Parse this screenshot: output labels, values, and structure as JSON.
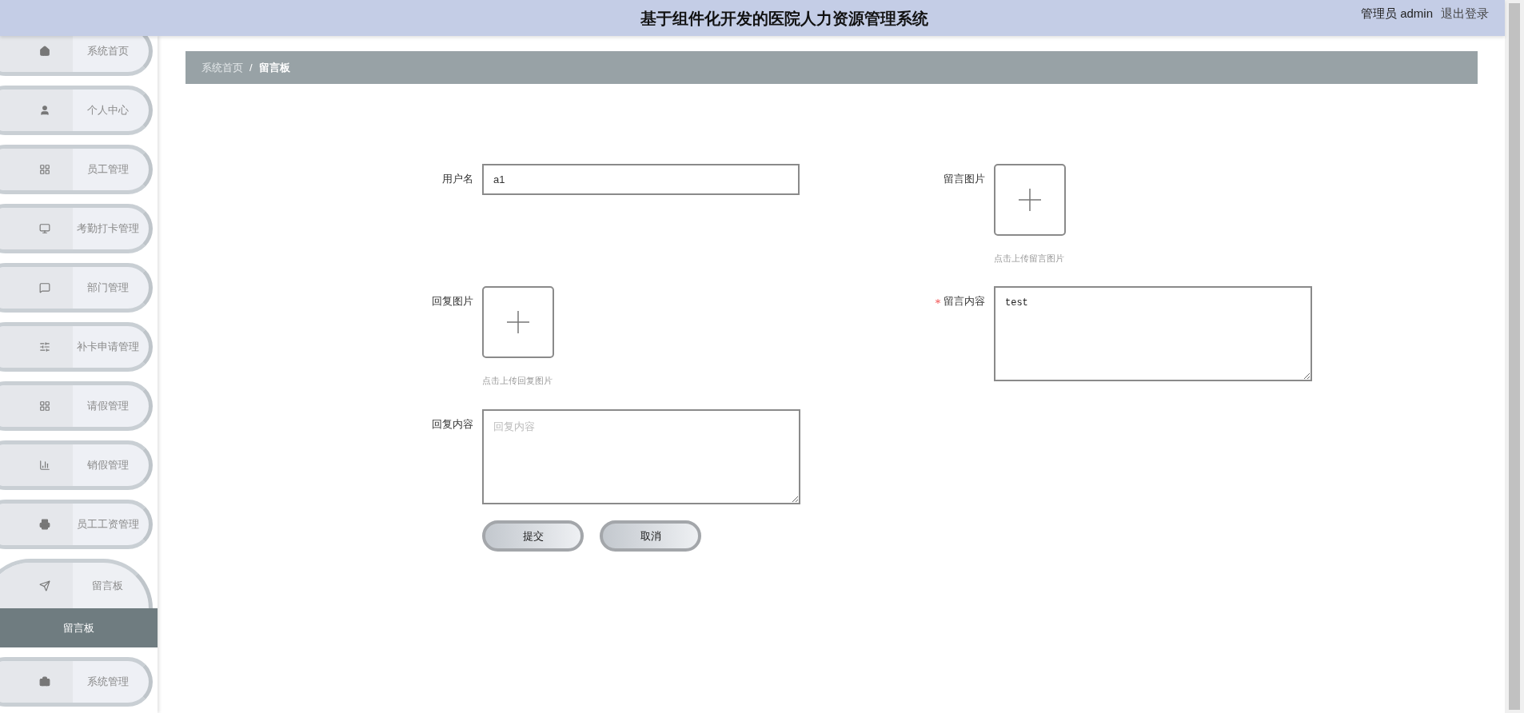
{
  "header": {
    "title": "基于组件化开发的医院人力资源管理系统",
    "user_label": "管理员 admin",
    "logout": "退出登录"
  },
  "sidebar": {
    "items": [
      {
        "label": "系统首页",
        "expanded": false
      },
      {
        "label": "个人中心",
        "expanded": false
      },
      {
        "label": "员工管理",
        "expanded": false
      },
      {
        "label": "考勤打卡管理",
        "expanded": false
      },
      {
        "label": "部门管理",
        "expanded": false
      },
      {
        "label": "补卡申请管理",
        "expanded": false
      },
      {
        "label": "请假管理",
        "expanded": false
      },
      {
        "label": "销假管理",
        "expanded": false
      },
      {
        "label": "员工工资管理",
        "expanded": false
      },
      {
        "label": "留言板",
        "expanded": true,
        "children": [
          {
            "label": "留言板",
            "selected": true
          }
        ]
      },
      {
        "label": "系统管理",
        "expanded": false
      }
    ]
  },
  "breadcrumb": {
    "separator": "/",
    "items": [
      {
        "label": "系统首页",
        "current": false
      },
      {
        "label": "留言板",
        "current": true
      }
    ]
  },
  "form": {
    "rows": [
      [
        {
          "kind": "text",
          "label": "用户名",
          "value": "a1",
          "required": false
        },
        {
          "kind": "upload",
          "label": "留言图片",
          "hint": "点击上传留言图片",
          "required": false
        }
      ],
      [
        {
          "kind": "upload",
          "label": "回复图片",
          "hint": "点击上传回复图片",
          "required": false
        },
        {
          "kind": "textarea",
          "label": "留言内容",
          "value": "test",
          "required": true
        }
      ],
      [
        {
          "kind": "textarea",
          "label": "回复内容",
          "placeholder": "回复内容",
          "required": false
        }
      ]
    ],
    "buttons": [
      {
        "label": "提交"
      },
      {
        "label": "取消"
      }
    ]
  }
}
